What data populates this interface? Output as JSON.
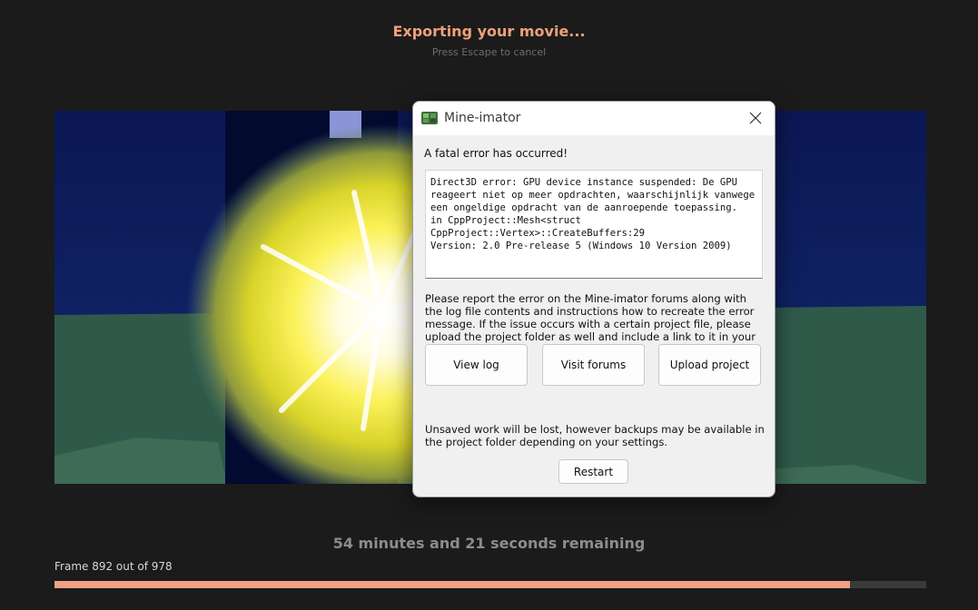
{
  "export": {
    "title": "Exporting your movie...",
    "subtitle": "Press Escape to cancel",
    "remaining": "54 minutes and 21 seconds remaining",
    "frame_label": "Frame 892 out of 978",
    "progress_fraction": 0.912,
    "progress_color": "#f0a184",
    "title_color": "#f0a07a"
  },
  "dialog": {
    "title": "Mine-imator",
    "heading": "A fatal error has occurred!",
    "error_text": "Direct3D error: GPU device instance suspended: De GPU reageert niet op meer opdrachten, waarschijnlijk vanwege een ongeldige opdracht van de aanroepende toepassing.\nin CppProject::Mesh<struct CppProject::Vertex>::CreateBuffers:29\nVersion: 2.0 Pre-release 5 (Windows 10 Version 2009)",
    "report_text": "Please report the error on the Mine-imator forums along with the log file contents and instructions how to recreate the error message. If the issue occurs with a certain project file, please upload the project folder as well and include a link to it in your topic.",
    "buttons": {
      "view_log": "View log",
      "visit_forums": "Visit forums",
      "upload_project": "Upload project"
    },
    "unsaved_text": "Unsaved work will be lost, however backups may be available in the project folder depending on your settings.",
    "restart_label": "Restart",
    "icons": {
      "app": "mine-imator-app-icon",
      "close": "close-icon"
    }
  }
}
